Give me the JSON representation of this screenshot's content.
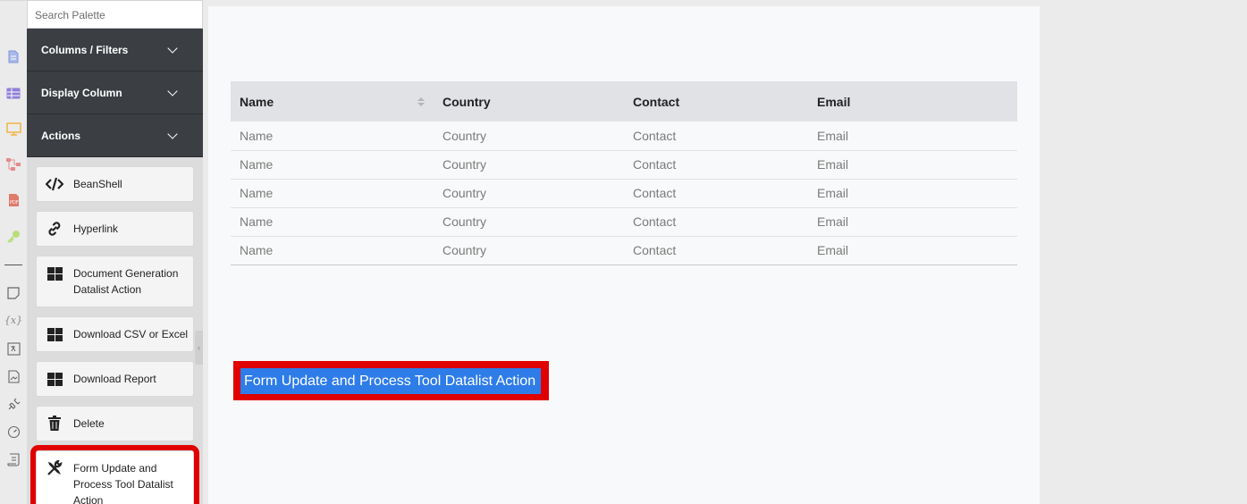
{
  "rail": {
    "icons": [
      "document-icon",
      "table-icon",
      "monitor-icon",
      "flow-icon",
      "pdf-icon",
      "key-icon",
      "note-icon",
      "variable-icon",
      "translate-icon",
      "image-file-icon",
      "plugin-icon",
      "gauge-icon",
      "script-icon"
    ],
    "variable_glyph": "{x}"
  },
  "palette": {
    "search_placeholder": "Search Palette",
    "sections": [
      {
        "label": "Columns / Filters"
      },
      {
        "label": "Display Column"
      },
      {
        "label": "Actions"
      }
    ],
    "actions": [
      {
        "label": "BeanShell",
        "icon": "code-icon"
      },
      {
        "label": "Hyperlink",
        "icon": "link-icon"
      },
      {
        "label": "Document Generation Datalist Action",
        "icon": "grid-icon"
      },
      {
        "label": "Download CSV or Excel",
        "icon": "grid-icon"
      },
      {
        "label": "Download Report",
        "icon": "grid-icon"
      },
      {
        "label": "Delete",
        "icon": "trash-icon"
      },
      {
        "label": "Form Update and Process Tool Datalist Action",
        "icon": "tools-icon"
      }
    ]
  },
  "table": {
    "headers": [
      "Name",
      "Country",
      "Contact",
      "Email"
    ],
    "rows": [
      [
        "Name",
        "Country",
        "Contact",
        "Email"
      ],
      [
        "Name",
        "Country",
        "Contact",
        "Email"
      ],
      [
        "Name",
        "Country",
        "Contact",
        "Email"
      ],
      [
        "Name",
        "Country",
        "Contact",
        "Email"
      ],
      [
        "Name",
        "Country",
        "Contact",
        "Email"
      ]
    ]
  },
  "canvas_action": {
    "label": "Form Update and Process Tool Datalist Action"
  },
  "colors": {
    "highlight": "#e00000",
    "action_button": "#2e7ce8",
    "palette_header": "#3b3f44"
  }
}
